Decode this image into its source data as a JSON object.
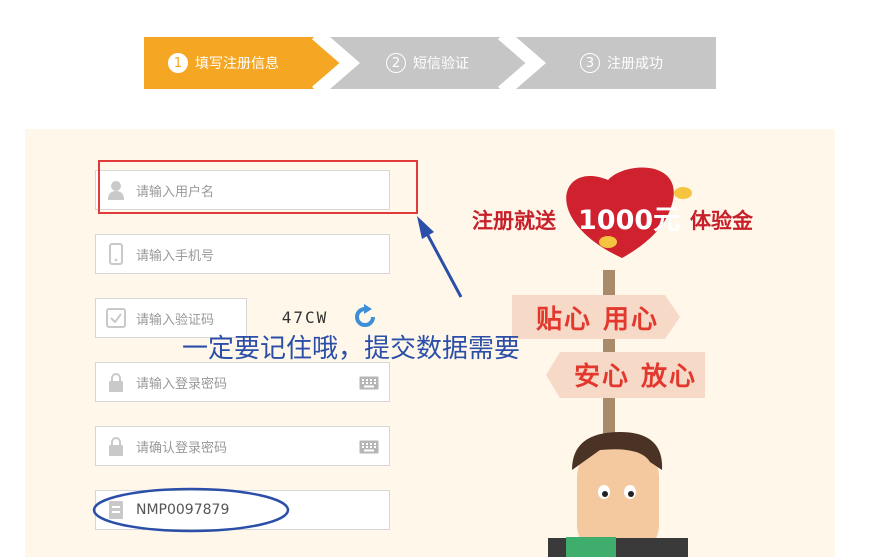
{
  "steps": [
    {
      "num": "1",
      "label": "填写注册信息",
      "state": "active"
    },
    {
      "num": "2",
      "label": "短信验证",
      "state": "inactive"
    },
    {
      "num": "3",
      "label": "注册成功",
      "state": "inactive"
    }
  ],
  "form": {
    "username_placeholder": "请输入用户名",
    "phone_placeholder": "请输入手机号",
    "captcha_placeholder": "请输入验证码",
    "captcha_image_text": "47CW",
    "password_placeholder": "请输入登录密码",
    "confirm_placeholder": "请确认登录密码",
    "invite_code_value": "NMP0097879"
  },
  "annotation": {
    "note": "一定要记住哦，提交数据需要"
  },
  "promo": {
    "left": "注册就送",
    "amount": "1000元",
    "right": "体验金",
    "sign_top": "贴心 用心",
    "sign_bottom": "安心 放心"
  },
  "colors": {
    "step_active": "#f5a623",
    "step_inactive": "#c6c6c6",
    "panel_bg": "#fff7ea",
    "annotation_red": "#e03b3b",
    "annotation_blue": "#2b4fa9"
  }
}
